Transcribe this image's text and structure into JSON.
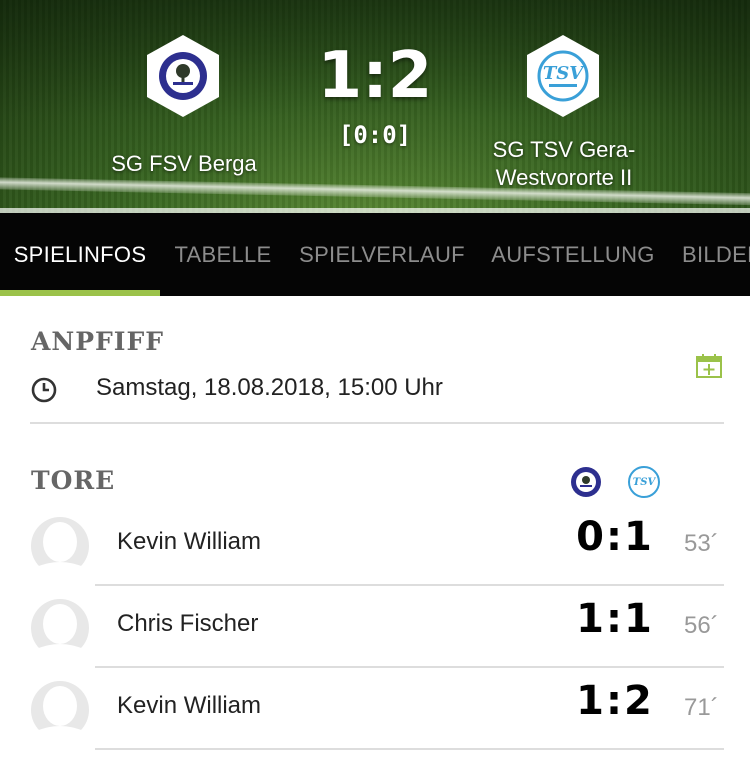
{
  "match": {
    "home_team": "SG FSV Berga",
    "away_team_line1": "SG TSV Gera-",
    "away_team_line2": "Westvororte II",
    "score": "1:2",
    "halftime": "[0:0]",
    "home_logo_icon": "fsv-berga-logo-icon",
    "away_logo_icon": "tsv-gera-logo-icon"
  },
  "tabs": [
    {
      "label": "SPIELINFOS",
      "active": true
    },
    {
      "label": "TABELLE",
      "active": false
    },
    {
      "label": "SPIELVERLAUF",
      "active": false
    },
    {
      "label": "AUFSTELLUNG",
      "active": false
    },
    {
      "label": "BILDER",
      "active": false
    }
  ],
  "kickoff": {
    "title": "ANPFIFF",
    "datetime": "Samstag, 18.08.2018, 15:00 Uhr",
    "icon": "clock-icon",
    "action_icon": "calendar-add-icon"
  },
  "goals": {
    "title": "TORE",
    "items": [
      {
        "player": "Kevin William",
        "score": "0:1",
        "minute": "53´"
      },
      {
        "player": "Chris Fischer",
        "score": "1:1",
        "minute": "56´"
      },
      {
        "player": "Kevin William",
        "score": "1:2",
        "minute": "71´"
      }
    ]
  },
  "colors": {
    "accent": "#9bc24a",
    "tab_bar": "#050505",
    "home_logo": "#2d2f8f",
    "away_logo": "#3aa0d8"
  }
}
